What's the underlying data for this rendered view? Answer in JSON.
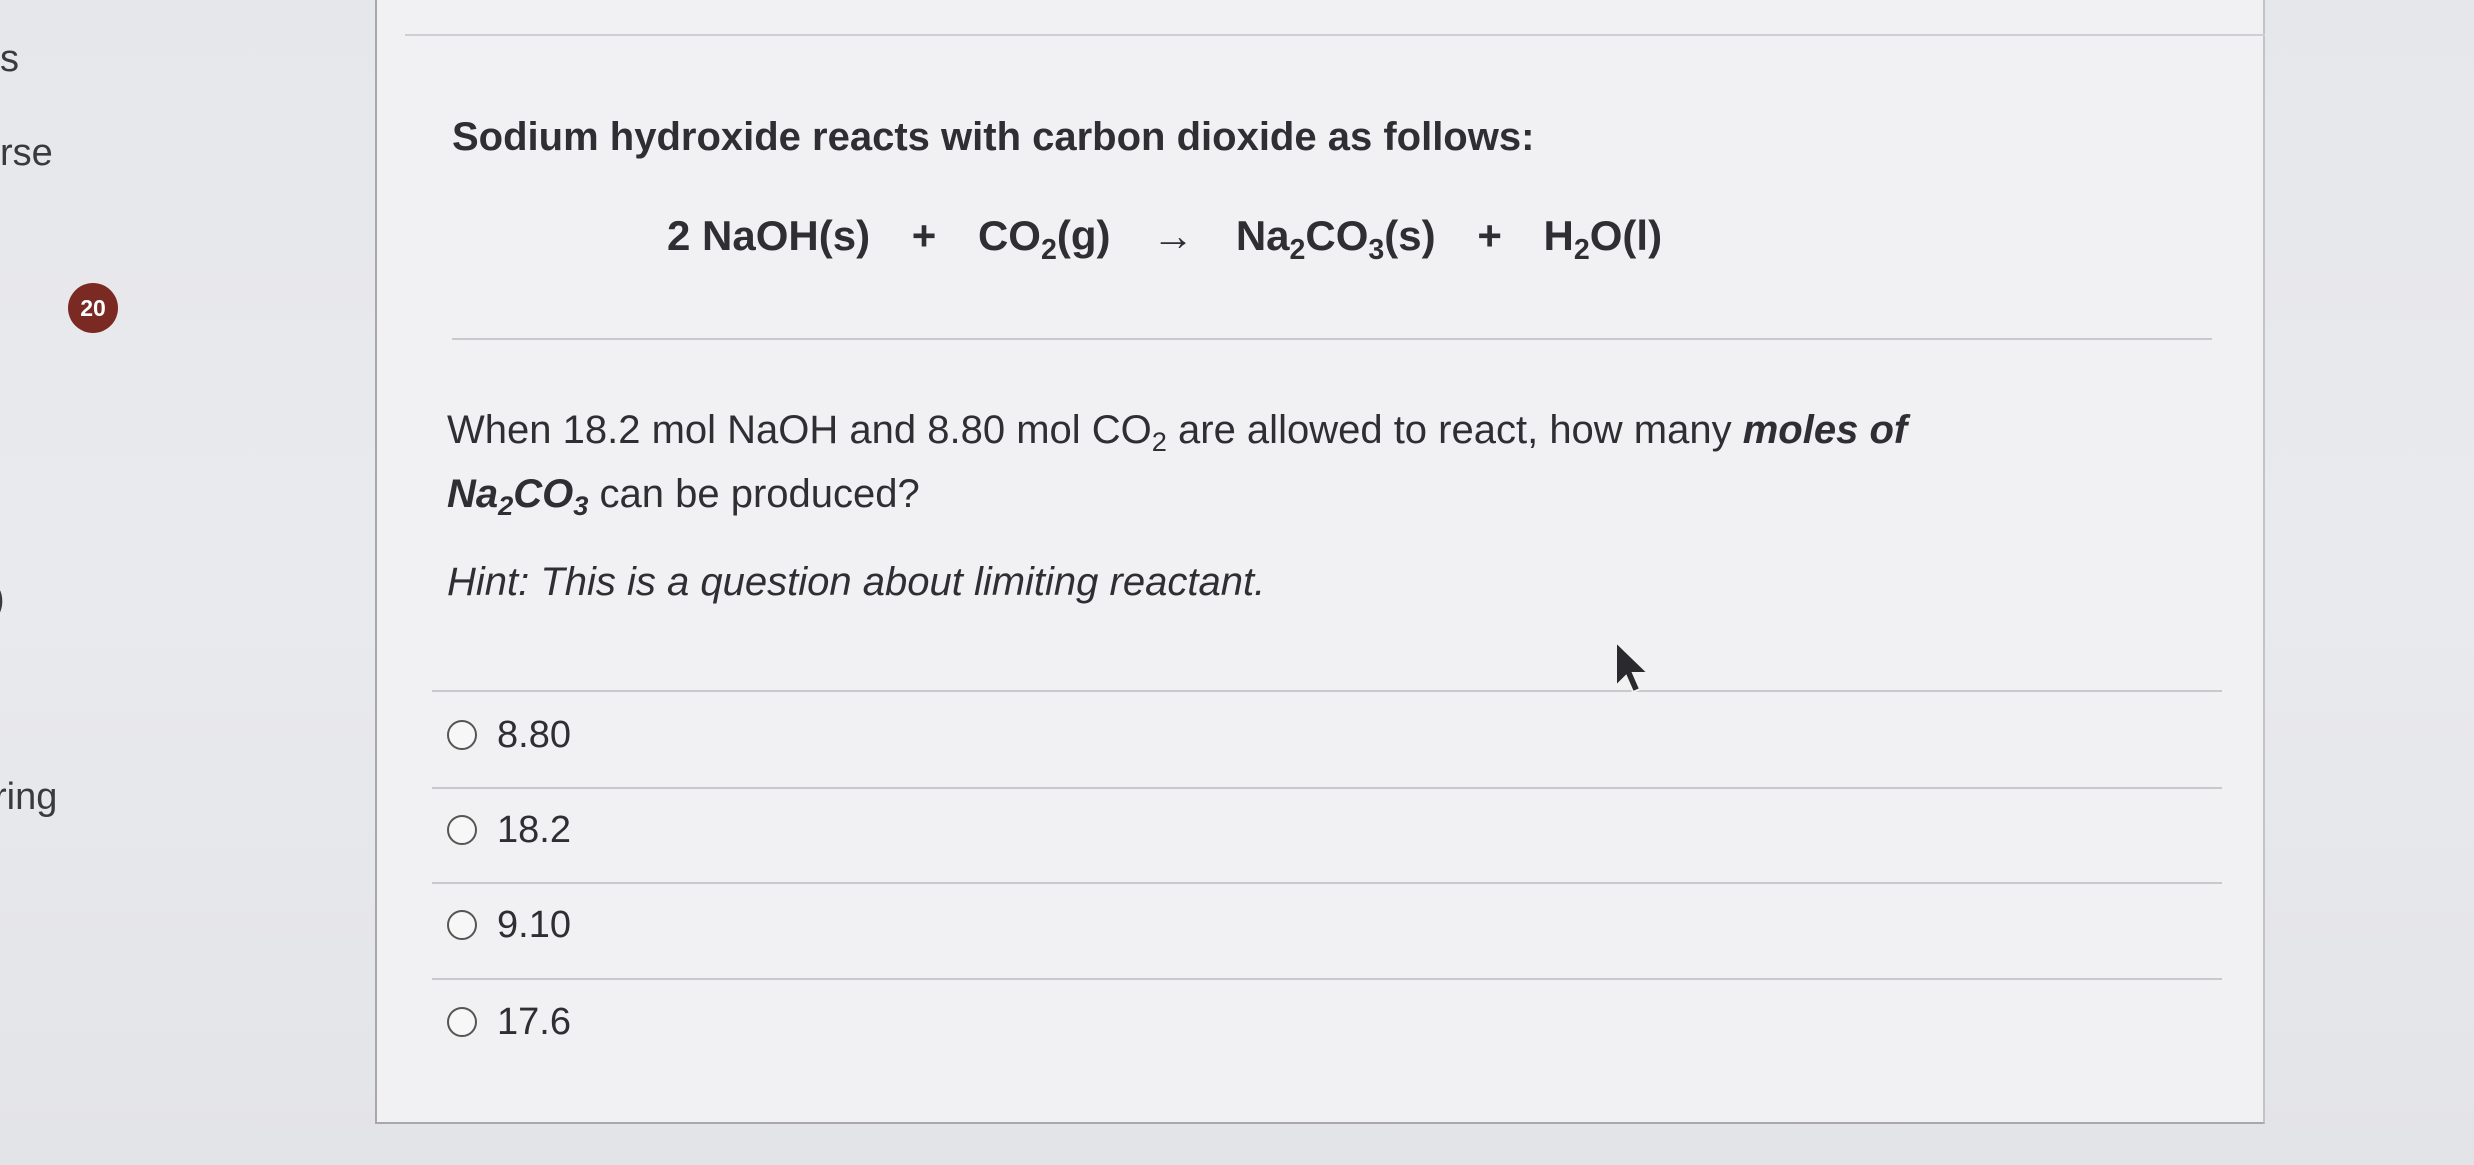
{
  "sidebar": {
    "items": [
      {
        "text": "s"
      },
      {
        "text": "rse"
      },
      {
        "text": ")"
      },
      {
        "text": "ring"
      }
    ],
    "badge": "20"
  },
  "question": {
    "intro": "Sodium hydroxide reacts with carbon dioxide as follows:",
    "equation": {
      "coef1": "2",
      "reactant1": "NaOH(s)",
      "plus": "+",
      "reactant2_base": "CO",
      "reactant2_sub": "2",
      "reactant2_state": "(g)",
      "arrow": "→",
      "product1_base1": "Na",
      "product1_sub1": "2",
      "product1_base2": "CO",
      "product1_sub2": "3",
      "product1_state": "(s)",
      "product2_base": "H",
      "product2_sub": "2",
      "product2_rest": "O(l)"
    },
    "prompt": {
      "part1": "When 18.2 mol NaOH and 8.80 mol CO",
      "sub1": "2",
      "part2": " are allowed to react, how many ",
      "bold": "moles of",
      "na": "Na",
      "sub2": "2",
      "co": "CO",
      "sub3": "3",
      "part3": " can be produced?"
    },
    "hint": "Hint: This is a question about limiting reactant.",
    "options": [
      "8.80",
      "18.2",
      "9.10",
      "17.6"
    ]
  }
}
